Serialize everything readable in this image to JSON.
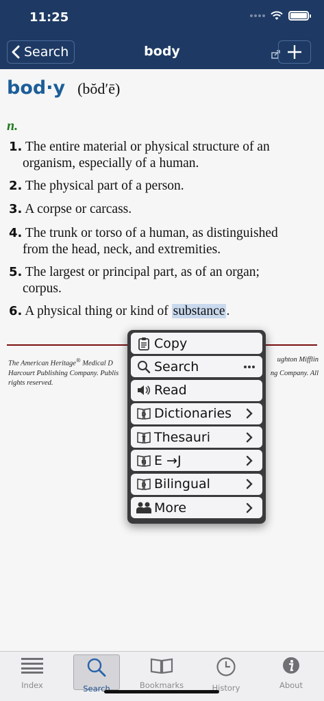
{
  "status_bar": {
    "time": "11:25"
  },
  "nav": {
    "back_label": "Search",
    "title": "body"
  },
  "entry": {
    "headword": "bod·y",
    "pronunciation": "(bŏd′ē)",
    "part_of_speech": "n.",
    "senses": [
      {
        "number": "1.",
        "line1": "The entire material or physical structure of an",
        "line2": "organism, especially of a human."
      },
      {
        "number": "2.",
        "line1": "The physical part of a person.",
        "line2": ""
      },
      {
        "number": "3.",
        "line1": "A corpse or carcass.",
        "line2": ""
      },
      {
        "number": "4.",
        "line1": "The trunk or torso of a human, as distinguished",
        "line2": "from the head, neck, and extremities."
      },
      {
        "number": "5.",
        "line1": "The largest or principal part, as of an organ;",
        "line2": "corpus."
      },
      {
        "number": "6.",
        "line1_before": "A physical thing or kind of ",
        "selected": "substance",
        "line1_after": "."
      }
    ],
    "copyright_left_1": "The American Heritage",
    "copyright_reg": "®",
    "copyright_left_1b": " Medical D",
    "copyright_right_1": "ughton Mifflin",
    "copyright_left_2": "Harcourt Publishing Company. Publis",
    "copyright_right_2": "ng Company. All",
    "copyright_3": "rights reserved."
  },
  "popover_menu": [
    {
      "label": "Copy",
      "icon": "clipboard-icon",
      "trail": ""
    },
    {
      "label": "Search",
      "icon": "magnifier-icon",
      "trail": "more-icon"
    },
    {
      "label": "Read",
      "icon": "speaker-icon",
      "trail": ""
    },
    {
      "label": "Dictionaries",
      "icon": "dictionary-book-icon",
      "trail": "chevron-right-icon"
    },
    {
      "label": "Thesauri",
      "icon": "thesaurus-book-icon",
      "trail": "chevron-right-icon"
    },
    {
      "label": "E →J",
      "icon": "ej-book-icon",
      "trail": "chevron-right-icon"
    },
    {
      "label": "Bilingual",
      "icon": "bilingual-book-icon",
      "trail": "chevron-right-icon"
    },
    {
      "label": "More",
      "icon": "people-icon",
      "trail": "chevron-right-icon"
    }
  ],
  "tabs": [
    {
      "label": "Index",
      "icon": "list-icon",
      "active": false
    },
    {
      "label": "Search",
      "icon": "search-icon",
      "active": true
    },
    {
      "label": "Bookmarks",
      "icon": "open-book-icon",
      "active": false
    },
    {
      "label": "History",
      "icon": "clock-icon",
      "active": false
    },
    {
      "label": "About",
      "icon": "info-icon",
      "active": false
    }
  ],
  "colors": {
    "nav_bar": "#1e3a64",
    "headword": "#1c5e99",
    "pos": "#1f7a1f",
    "divider": "#7a0f0f",
    "selection": "#c9d9ee",
    "active_tab_label": "#1b4f8c"
  }
}
